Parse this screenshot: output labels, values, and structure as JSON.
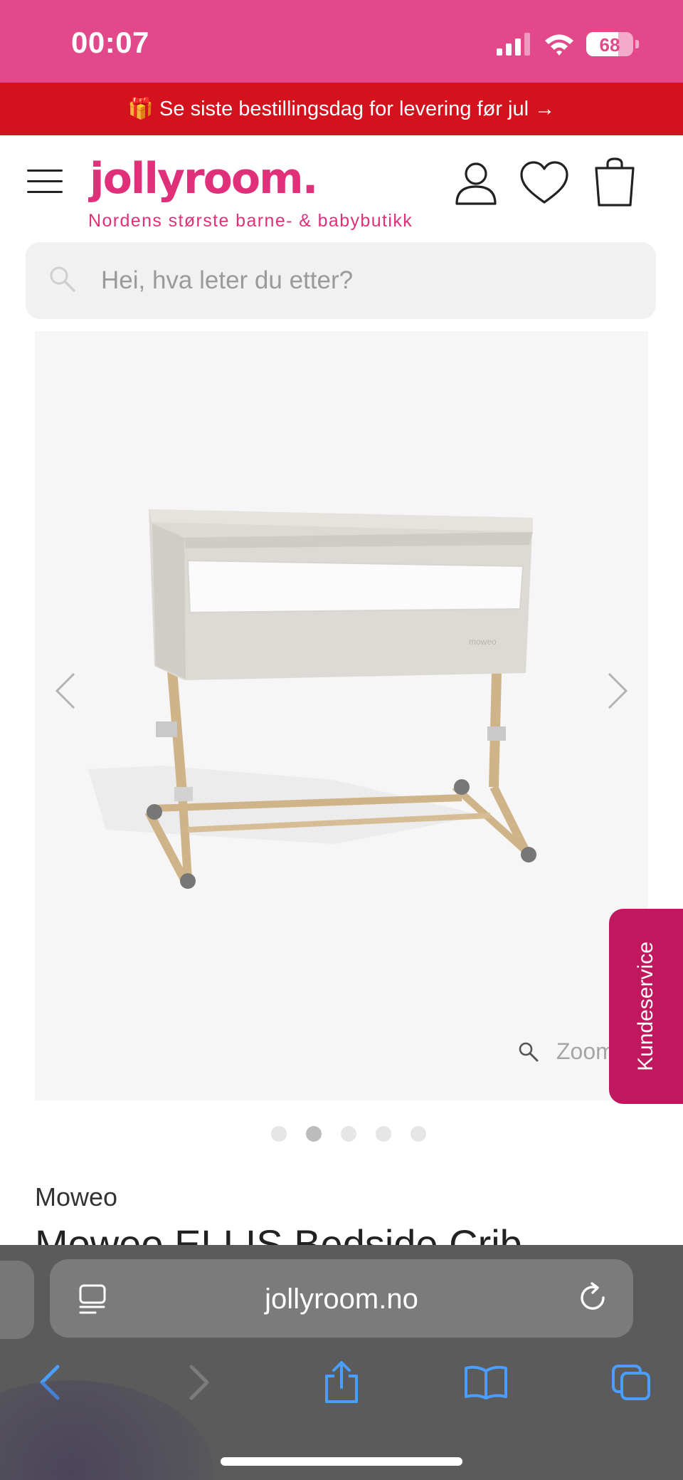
{
  "status_bar": {
    "time": "00:07",
    "battery_percent": "68",
    "battery_level": 0.68,
    "signal_icon": "cellular-signal-icon",
    "wifi_icon": "wifi-icon"
  },
  "promo": {
    "icon": "gift-icon",
    "text": "🎁 Se siste bestillingsdag for levering før jul →"
  },
  "header": {
    "logo": "jollyroom.",
    "tagline": "Nordens største barne- & babybutikk",
    "icons": [
      "menu-icon",
      "account-icon",
      "wishlist-heart-icon",
      "cart-bag-icon"
    ]
  },
  "search": {
    "placeholder": "Hei, hva leter du etter?"
  },
  "gallery": {
    "zoom_label": "Zoom",
    "dots_total": 5,
    "active_dot": 2,
    "prev_icon": "chevron-left-icon",
    "next_icon": "chevron-right-icon",
    "image": "bedside-crib-photo"
  },
  "side_tab": {
    "label": "Kundeservice"
  },
  "product": {
    "brand": "Moweo",
    "title": "Moweo ELLIS Bedside Crib"
  },
  "browser": {
    "url": "jollyroom.no",
    "toolbar": [
      "back-icon",
      "forward-icon",
      "share-icon",
      "bookmarks-icon",
      "tabs-icon"
    ]
  },
  "colors": {
    "brand_pink": "#e0307a",
    "status_bar": "#e2488a",
    "promo_red": "#d3121e",
    "side_tab": "#c0185e",
    "safari_blue": "#4a9eff"
  }
}
